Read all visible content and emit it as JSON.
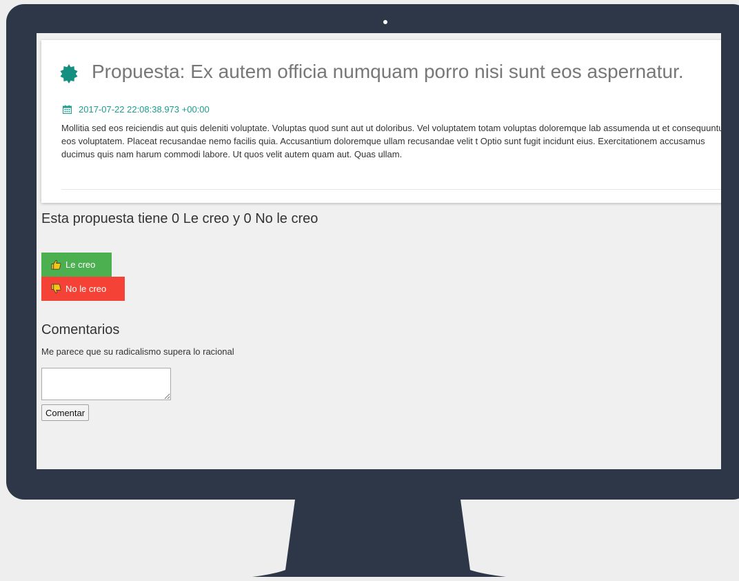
{
  "proposal": {
    "title": "Propuesta: Ex autem officia numquam porro nisi sunt eos aspernatur.",
    "date": "2017-07-22 22:08:38.973 +00:00",
    "body": "Mollitia sed eos reiciendis aut quis deleniti voluptate. Voluptas quod sunt aut ut doloribus. Vel voluptatem totam voluptas doloremque lab assumenda ut et consequuntur eos voluptatem. Placeat recusandae nemo facilis quia. Accusantium doloremque ullam recusandae velit t Optio sunt fugit incidunt eius. Exercitationem accusamus ducimus quis nam harum commodi labore. Ut quos velit autem quam aut. Quas ullam.",
    "icon": "badge-icon",
    "date_icon": "calendar-icon"
  },
  "votes": {
    "summary": "Esta propuesta tiene 0 Le creo y 0 No le creo",
    "yes_label": "Le creo",
    "no_label": "No le creo",
    "yes_color": "#4caf50",
    "no_color": "#f44336",
    "yes_icon": "thumbs-up-icon",
    "no_icon": "thumbs-down-icon"
  },
  "comments": {
    "title": "Comentarios",
    "items": [
      "Me parece que su radicalismo supera lo racional"
    ],
    "input_value": "",
    "submit_label": "Comentar"
  },
  "colors": {
    "accent": "#1a9d8f",
    "frame": "#2d3748"
  }
}
